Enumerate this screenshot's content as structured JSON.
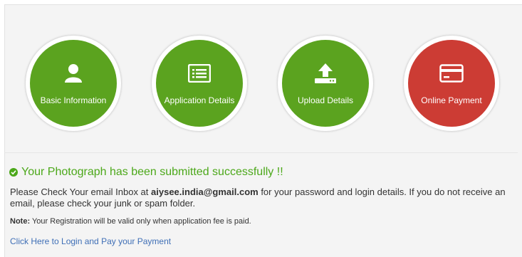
{
  "steps": [
    {
      "label": "Basic Information",
      "icon": "user-icon",
      "color": "#5ba31f"
    },
    {
      "label": "Application Details",
      "icon": "list-card-icon",
      "color": "#5ba31f"
    },
    {
      "label": "Upload Details",
      "icon": "upload-icon",
      "color": "#5ba31f"
    },
    {
      "label": "Online Payment",
      "icon": "credit-card-icon",
      "color": "#cc3c34"
    }
  ],
  "success_message": "Your Photograph has been submitted successfully !!",
  "info": {
    "prefix": "Please Check Your email Inbox at ",
    "email": "aiysee.india@gmail.com",
    "suffix": " for your password and login details. If you do not receive an email, please check your junk or spam folder."
  },
  "note": {
    "label": "Note:",
    "text": " Your Registration will be valid only when application fee is paid."
  },
  "login_link": "Click Here to Login and Pay your Payment",
  "colors": {
    "accent_green": "#4ca81a",
    "link_blue": "#3f6fb6",
    "panel_bg": "#f4f4f4"
  }
}
